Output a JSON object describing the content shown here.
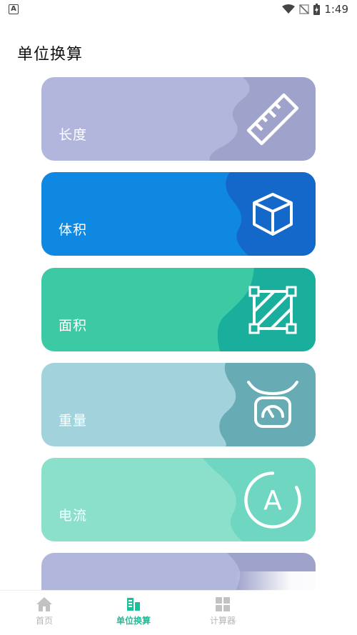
{
  "status_bar": {
    "app_badge": "A",
    "time": "1:49",
    "icons": [
      "wifi-icon",
      "signal-off-icon",
      "battery-charging-icon"
    ]
  },
  "page": {
    "title": "单位换算"
  },
  "cards": [
    {
      "label": "长度",
      "icon": "ruler-icon",
      "color": "#b2b6dc",
      "wave_color": "#9fa3cb"
    },
    {
      "label": "体积",
      "icon": "cube-icon",
      "color": "#0f88e2",
      "wave_color": "#1468c9"
    },
    {
      "label": "面积",
      "icon": "area-square-icon",
      "color": "#3ccaa4",
      "wave_color": "#1aaf9c"
    },
    {
      "label": "重量",
      "icon": "scale-icon",
      "color": "#a2d3dc",
      "wave_color": "#67abb5"
    },
    {
      "label": "电流",
      "icon": "ampere-icon",
      "color": "#8ae0cb",
      "wave_color": "#6fd6c2"
    },
    {
      "label": "",
      "icon": "",
      "color": "#b2b6dc",
      "wave_color": "#9fa3cb"
    }
  ],
  "bottom_nav": [
    {
      "label": "首页",
      "icon": "home-icon",
      "active": false
    },
    {
      "label": "单位换算",
      "icon": "convert-icon",
      "active": true
    },
    {
      "label": "计算器",
      "icon": "calculator-icon",
      "active": false
    }
  ],
  "colors": {
    "accent": "#1bbf9a",
    "inactive": "#b5b5b5"
  }
}
